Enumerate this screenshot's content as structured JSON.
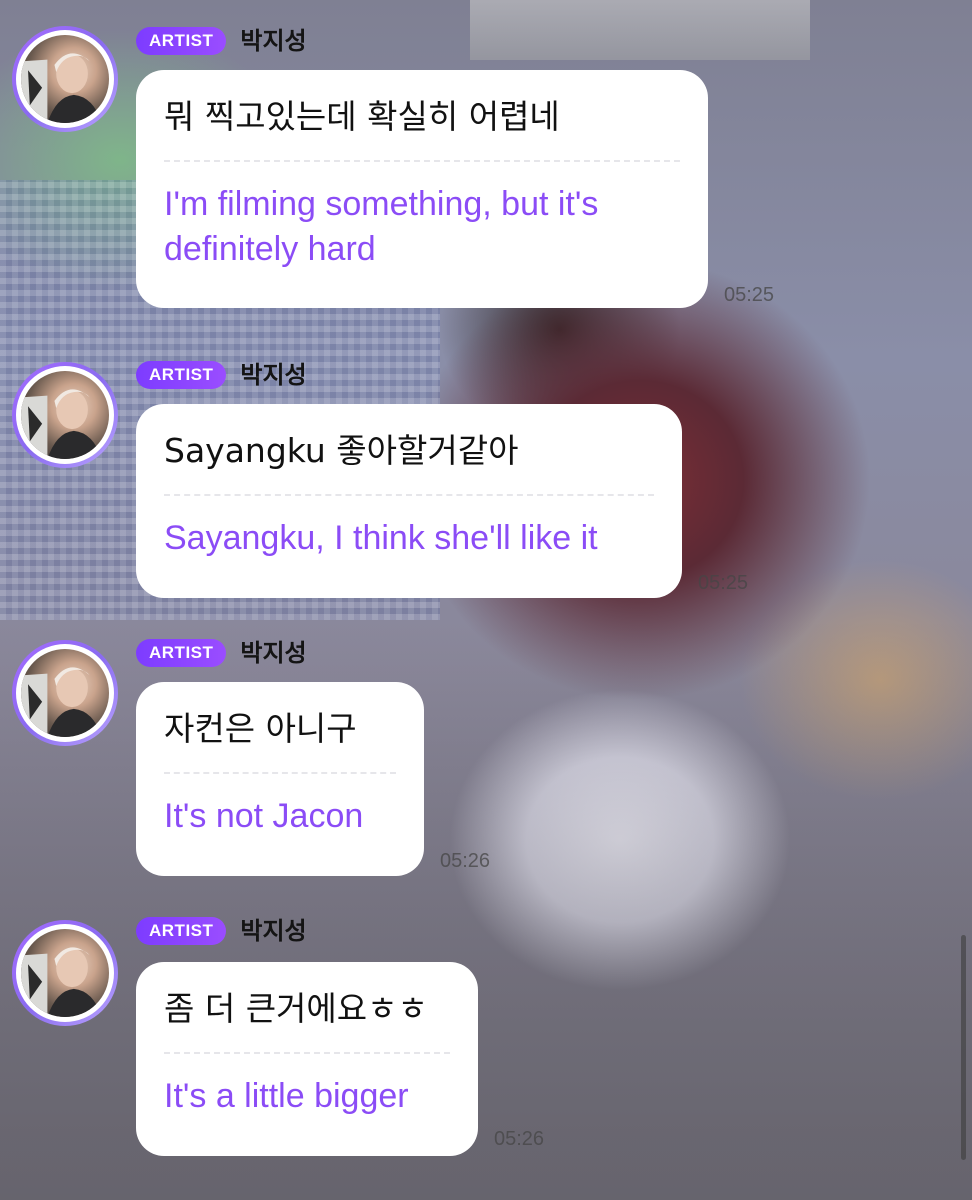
{
  "messages": [
    {
      "badge": "ARTIST",
      "name": "박지성",
      "original": "뭐 찍고있는데 확실히 어렵네",
      "translation_line1": "I'm filming something, but it's",
      "translation_line2": "definitely hard",
      "time": "05:25"
    },
    {
      "badge": "ARTIST",
      "name": "박지성",
      "original": "Sayangku 좋아할거같아",
      "translation_line1": "Sayangku, I think she'll like it",
      "time": "05:25"
    },
    {
      "badge": "ARTIST",
      "name": "박지성",
      "original": "자컨은 아니구",
      "translation_line1": "It's not Jacon",
      "time": "05:26"
    },
    {
      "badge": "ARTIST",
      "name": "박지성",
      "original": "좀 더 큰거에요ㅎㅎ",
      "translation_line1": "It's a little bigger",
      "time": "05:26"
    }
  ],
  "colors": {
    "badge": "#8b45ff",
    "translation": "#8b4cf6",
    "bubble": "#ffffff"
  }
}
